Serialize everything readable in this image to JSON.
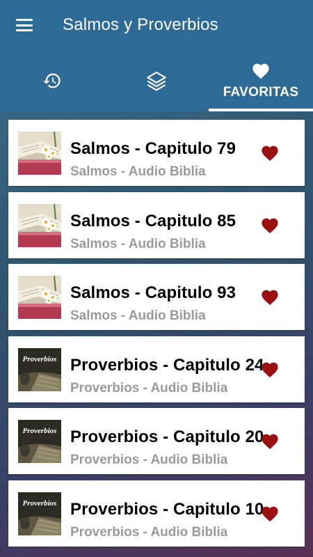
{
  "app": {
    "title": "Salmos y Proverbios"
  },
  "colors": {
    "primary": "#2e6a96",
    "heart": "#9b1010",
    "subtitle": "#9a9a9a"
  },
  "tabs": [
    {
      "icon": "history-icon",
      "label": ""
    },
    {
      "icon": "layers-icon",
      "label": ""
    },
    {
      "icon": "heart-icon",
      "label": "FAVORITAS",
      "active": true
    }
  ],
  "items": [
    {
      "title": "Salmos - Capitulo 79",
      "subtitle": "Salmos - Audio Biblia",
      "thumb": "salmos"
    },
    {
      "title": "Salmos - Capitulo 85",
      "subtitle": "Salmos - Audio Biblia",
      "thumb": "salmos"
    },
    {
      "title": "Salmos - Capitulo 93",
      "subtitle": "Salmos - Audio Biblia",
      "thumb": "salmos"
    },
    {
      "title": "Proverbios - Capitulo 24",
      "subtitle": "Proverbios - Audio Biblia",
      "thumb": "proverbios",
      "thumb_text": "Proverbios"
    },
    {
      "title": "Proverbios - Capitulo 20",
      "subtitle": "Proverbios - Audio Biblia",
      "thumb": "proverbios",
      "thumb_text": "Proverbios"
    },
    {
      "title": "Proverbios - Capitulo 10",
      "subtitle": "Proverbios - Audio Biblia",
      "thumb": "proverbios",
      "thumb_text": "Proverbios"
    }
  ]
}
